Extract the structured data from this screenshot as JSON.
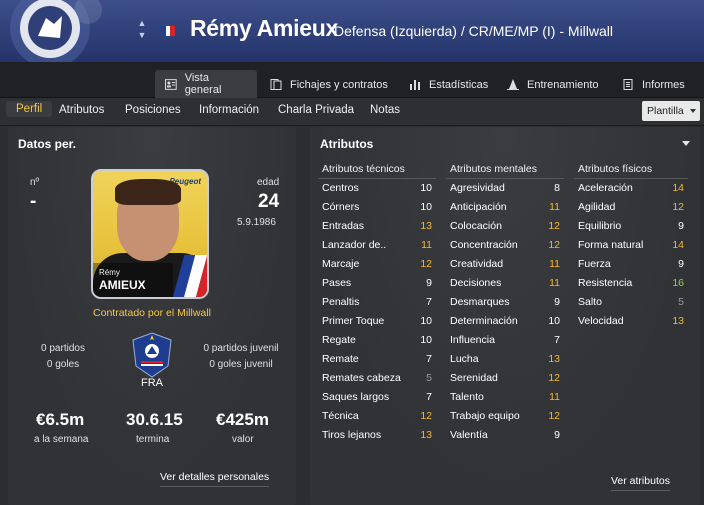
{
  "header": {
    "name": "Rémy Amieux",
    "subtitle": "Defensa (Izquierda) / CR/ME/MP (I) - Millwall",
    "crest_text": "MILLWALL FC"
  },
  "tabs": [
    {
      "label": "Vista general",
      "icon": "person-card-icon",
      "active": true
    },
    {
      "label": "Fichajes y contratos",
      "icon": "contract-icon"
    },
    {
      "label": "Estadísticas",
      "icon": "bar-chart-icon"
    },
    {
      "label": "Entrenamiento",
      "icon": "cone-icon"
    },
    {
      "label": "Informes",
      "icon": "report-icon"
    }
  ],
  "subnav": {
    "items": [
      "Perfil",
      "Atributos",
      "Posiciones",
      "Información",
      "Charla Privada",
      "Notas"
    ],
    "active": "Perfil",
    "dropdown": "Plantilla"
  },
  "personal": {
    "title": "Datos per.",
    "number_label": "nº",
    "number_value": "-",
    "age_label": "edad",
    "age_value": "24",
    "dob": "5.9.1986",
    "photo_club_logo": "Peugeot",
    "photo_first_name": "Rémy",
    "photo_last_name": "AMIEUX",
    "contract_text": "Contratado por el Millwall",
    "left_stats": [
      "0 partidos",
      "0 goles"
    ],
    "right_stats": [
      "0 partidos juvenil",
      "0 goles juvenil"
    ],
    "nation": "FRA",
    "wage_value": "€6.5m",
    "wage_label": "a la semana",
    "contract_end_value": "30.6.15",
    "contract_end_label": "termina",
    "value_value": "€425m",
    "value_label": "valor",
    "details_link": "Ver detalles personales"
  },
  "attributes": {
    "title": "Atributos",
    "link": "Ver atributos",
    "technical": {
      "heading": "Atributos técnicos",
      "rows": [
        {
          "name": "Centros",
          "value": "10",
          "tone": "white"
        },
        {
          "name": "Córners",
          "value": "10",
          "tone": "white"
        },
        {
          "name": "Entradas",
          "value": "13",
          "tone": "yellow"
        },
        {
          "name": "Lanzador de..",
          "value": "11",
          "tone": "yellow"
        },
        {
          "name": "Marcaje",
          "value": "12",
          "tone": "yellow"
        },
        {
          "name": "Pases",
          "value": "9",
          "tone": "white"
        },
        {
          "name": "Penaltis",
          "value": "7",
          "tone": "white"
        },
        {
          "name": "Primer Toque",
          "value": "10",
          "tone": "white"
        },
        {
          "name": "Regate",
          "value": "10",
          "tone": "white"
        },
        {
          "name": "Remate",
          "value": "7",
          "tone": "white"
        },
        {
          "name": "Remates cabeza",
          "value": "5",
          "tone": "grey"
        },
        {
          "name": "Saques largos",
          "value": "7",
          "tone": "white"
        },
        {
          "name": "Técnica",
          "value": "12",
          "tone": "yellow"
        },
        {
          "name": "Tiros lejanos",
          "value": "13",
          "tone": "yellow"
        }
      ]
    },
    "mental": {
      "heading": "Atributos mentales",
      "rows": [
        {
          "name": "Agresividad",
          "value": "8",
          "tone": "white"
        },
        {
          "name": "Anticipación",
          "value": "11",
          "tone": "yellow"
        },
        {
          "name": "Colocación",
          "value": "12",
          "tone": "yellow"
        },
        {
          "name": "Concentración",
          "value": "12",
          "tone": "yellow"
        },
        {
          "name": "Creatividad",
          "value": "11",
          "tone": "yellow"
        },
        {
          "name": "Decisiones",
          "value": "11",
          "tone": "yellow"
        },
        {
          "name": "Desmarques",
          "value": "9",
          "tone": "white"
        },
        {
          "name": "Determinación",
          "value": "10",
          "tone": "white"
        },
        {
          "name": "Influencia",
          "value": "7",
          "tone": "white"
        },
        {
          "name": "Lucha",
          "value": "13",
          "tone": "yellow"
        },
        {
          "name": "Serenidad",
          "value": "12",
          "tone": "yellow"
        },
        {
          "name": "Talento",
          "value": "11",
          "tone": "yellow"
        },
        {
          "name": "Trabajo equipo",
          "value": "12",
          "tone": "yellow"
        },
        {
          "name": "Valentía",
          "value": "9",
          "tone": "white"
        }
      ]
    },
    "physical": {
      "heading": "Atributos físicos",
      "rows": [
        {
          "name": "Aceleración",
          "value": "14",
          "tone": "yellow"
        },
        {
          "name": "Agilidad",
          "value": "12",
          "tone": "yellow"
        },
        {
          "name": "Equilibrio",
          "value": "9",
          "tone": "white"
        },
        {
          "name": "Forma natural",
          "value": "14",
          "tone": "yellow"
        },
        {
          "name": "Fuerza",
          "value": "9",
          "tone": "white"
        },
        {
          "name": "Resistencia",
          "value": "16",
          "tone": "green"
        },
        {
          "name": "Salto",
          "value": "5",
          "tone": "grey"
        },
        {
          "name": "Velocidad",
          "value": "13",
          "tone": "yellow"
        }
      ]
    }
  },
  "colors": {
    "header_blue": "#2f3f78",
    "accent_yellow": "#f5c842",
    "good_green": "#8fd14f",
    "muted_grey": "#9a9a9a"
  }
}
